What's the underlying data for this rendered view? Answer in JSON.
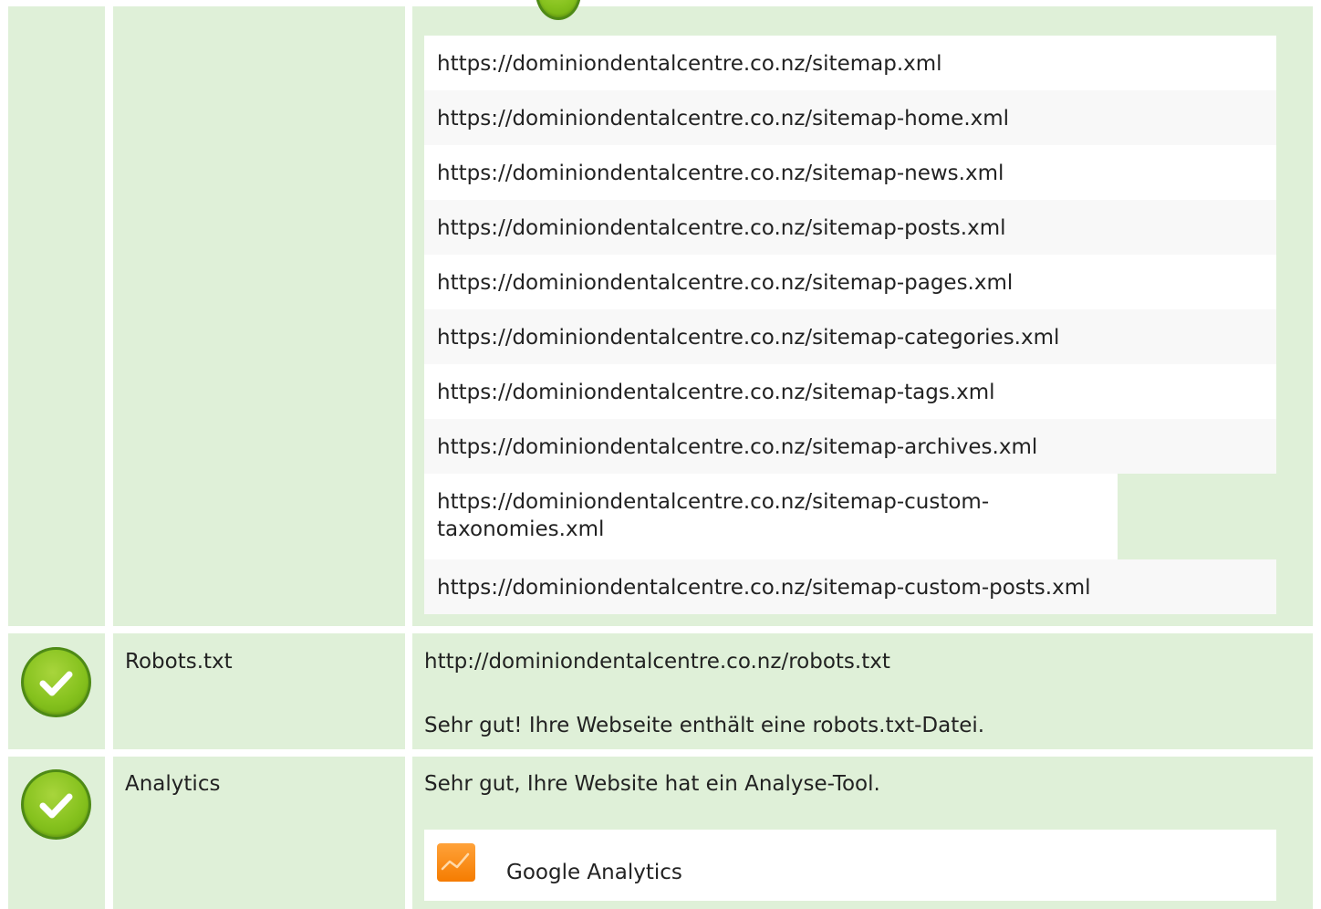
{
  "sitemaps": [
    "https://dominiondentalcentre.co.nz/sitemap.xml",
    "https://dominiondentalcentre.co.nz/sitemap-home.xml",
    "https://dominiondentalcentre.co.nz/sitemap-news.xml",
    "https://dominiondentalcentre.co.nz/sitemap-posts.xml",
    "https://dominiondentalcentre.co.nz/sitemap-pages.xml",
    "https://dominiondentalcentre.co.nz/sitemap-categories.xml",
    "https://dominiondentalcentre.co.nz/sitemap-tags.xml",
    "https://dominiondentalcentre.co.nz/sitemap-archives.xml",
    "https://dominiondentalcentre.co.nz/sitemap-custom-taxonomies.xml",
    "https://dominiondentalcentre.co.nz/sitemap-custom-posts.xml"
  ],
  "robots": {
    "label": "Robots.txt",
    "url": "http://dominiondentalcentre.co.nz/robots.txt",
    "message": "Sehr gut! Ihre Webseite enthält eine robots.txt-Datei."
  },
  "analytics": {
    "label": "Analytics",
    "message": "Sehr gut, Ihre Website hat ein Analyse-Tool.",
    "tool_name": "Google Analytics",
    "tool_icon": "google-analytics-icon"
  },
  "status_icon": "check-circle-icon",
  "colors": {
    "row_background": "#dff0d8",
    "check_green": "#86c21e",
    "analytics_orange": "#f57c00"
  }
}
